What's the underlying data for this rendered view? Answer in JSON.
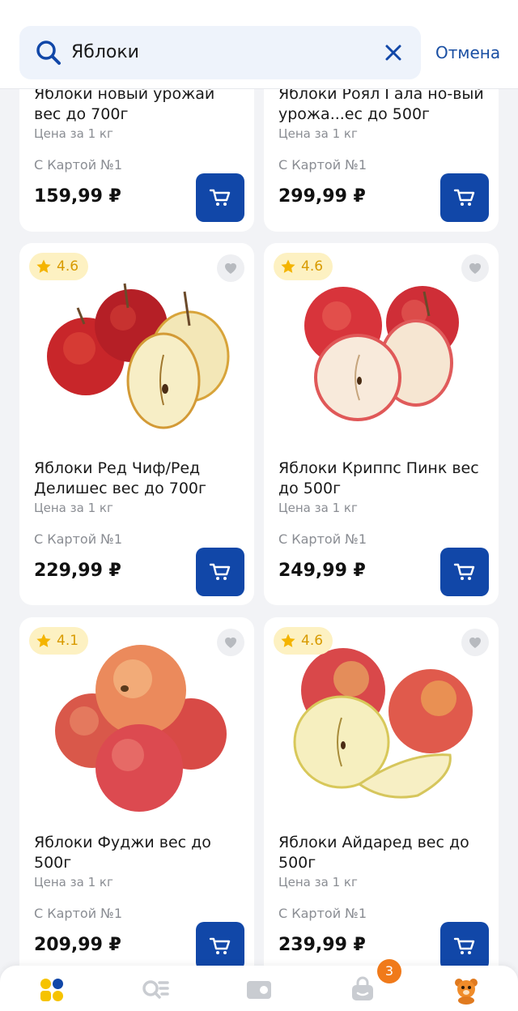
{
  "search": {
    "query": "Яблоки",
    "cancel_label": "Отмена"
  },
  "products": [
    {
      "title": "Яблоки новый урожай вес до 700г",
      "unit": "Цена за 1 кг",
      "card_label": "С Картой №1",
      "price": "159,99 ₽"
    },
    {
      "title": "Яблоки Роял Гала но-вый урожа...ес до 500г",
      "unit": "Цена за 1 кг",
      "card_label": "С Картой №1",
      "price": "299,99 ₽"
    },
    {
      "rating": "4.6",
      "title": "Яблоки Ред Чиф/Ред Делишес вес до 700г",
      "unit": "Цена за 1 кг",
      "card_label": "С Картой №1",
      "price": "229,99 ₽"
    },
    {
      "rating": "4.6",
      "title": "Яблоки Криппс Пинк вес до 500г",
      "unit": "Цена за 1 кг",
      "card_label": "С Картой №1",
      "price": "249,99 ₽"
    },
    {
      "rating": "4.1",
      "title": "Яблоки Фуджи вес до 500г",
      "unit": "Цена за 1 кг",
      "card_label": "С Картой №1",
      "price": "209,99 ₽"
    },
    {
      "rating": "4.6",
      "title": "Яблоки Айдаред вес до 500г",
      "unit": "Цена за 1 кг",
      "card_label": "С Картой №1",
      "price": "239,99 ₽"
    }
  ],
  "nav": {
    "items": [
      {
        "icon": "catalog-icon",
        "active": true
      },
      {
        "icon": "search-list-icon",
        "active": false
      },
      {
        "icon": "loyalty-card-icon",
        "active": false
      },
      {
        "icon": "basket-icon",
        "active": false
      },
      {
        "icon": "profile-mascot-icon",
        "active": false
      }
    ],
    "basket_count": "3"
  },
  "colors": {
    "accent": "#1147a8",
    "link": "#1a4fa3",
    "star": "#f4b400",
    "badge": "#f07a1a",
    "catalog_yellow": "#f6c300"
  }
}
